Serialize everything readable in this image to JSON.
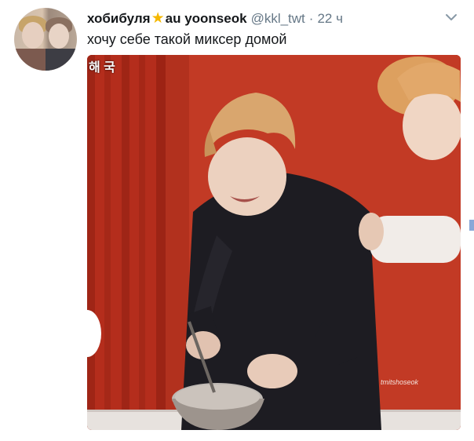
{
  "tweet": {
    "display_name": "хобибуля",
    "star_icon": "star-icon",
    "display_name_suffix": "au yoonseok",
    "handle": "@kkl_twt",
    "separator": "·",
    "time": "22 ч",
    "text": "хочу себе такой миксер домой"
  },
  "media": {
    "overlay_text": "해 국",
    "watermark": "tmitshoseok"
  },
  "icons": {
    "menu": "chevron-down-icon",
    "avatar": "avatar"
  },
  "colors": {
    "text": "#14171a",
    "muted": "#657786",
    "star": "#f5b800",
    "background_wall": "#b8301f"
  }
}
